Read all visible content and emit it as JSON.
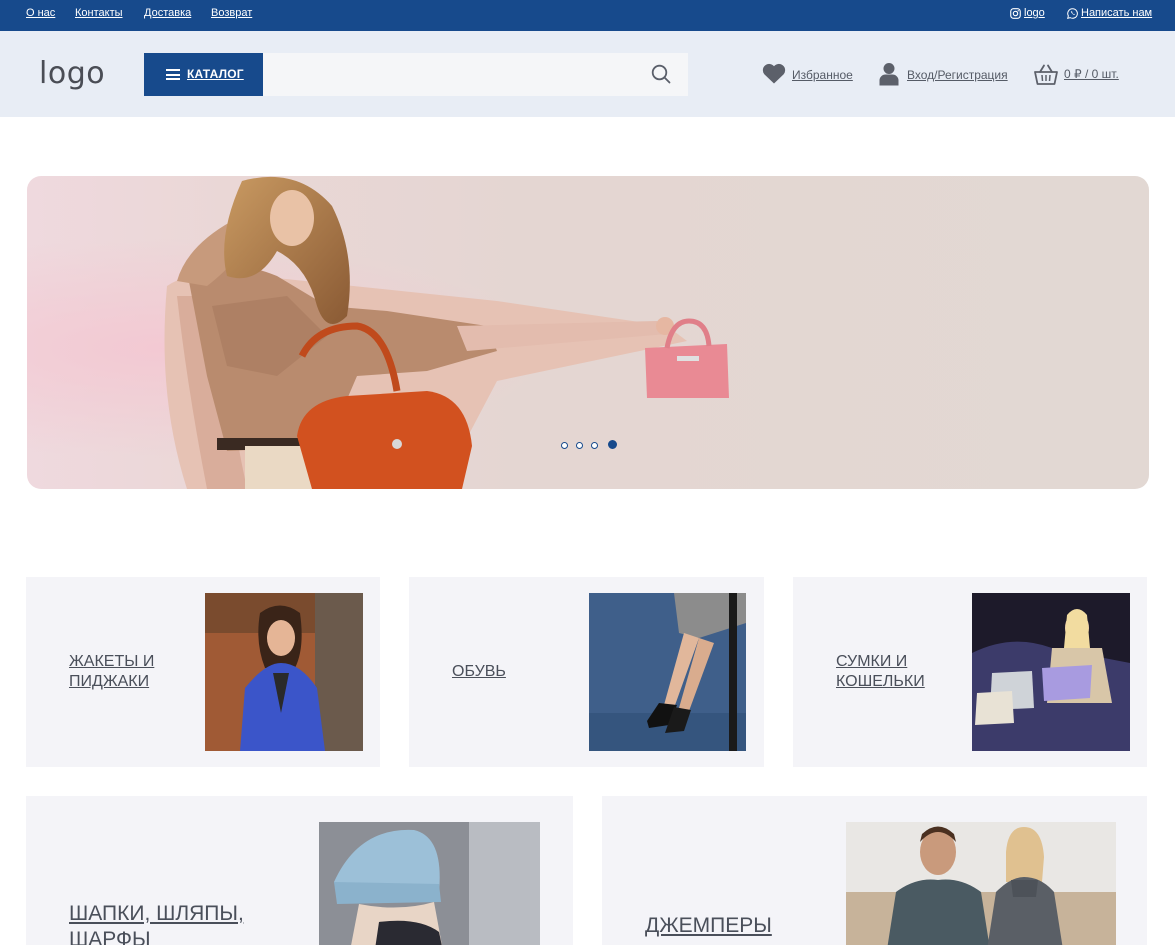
{
  "topbar": {
    "links": [
      "О нас",
      "Контакты",
      "Доставка",
      "Возврат"
    ],
    "instagram_label": "logo",
    "whatsapp_label": "Написать нам"
  },
  "header": {
    "logo": "logo",
    "catalog_label": "КАТАЛОГ",
    "search_value": "",
    "favorites_label": "Избранное",
    "login_label": "Вход/Регистрация",
    "cart_label": "0 ₽ / 0 шт."
  },
  "banner": {
    "slide_count": 4,
    "active_slide": 4
  },
  "categories": [
    {
      "label": "Жакеты и пиджаки"
    },
    {
      "label": "Обувь"
    },
    {
      "label": "Сумки и кошельки"
    },
    {
      "label": "Шапки, шляпы, шарфы"
    },
    {
      "label": "Джемперы"
    }
  ],
  "colors": {
    "brand": "#174a8c",
    "header_bg": "#e8edf5",
    "card_bg": "#f4f4f8"
  }
}
